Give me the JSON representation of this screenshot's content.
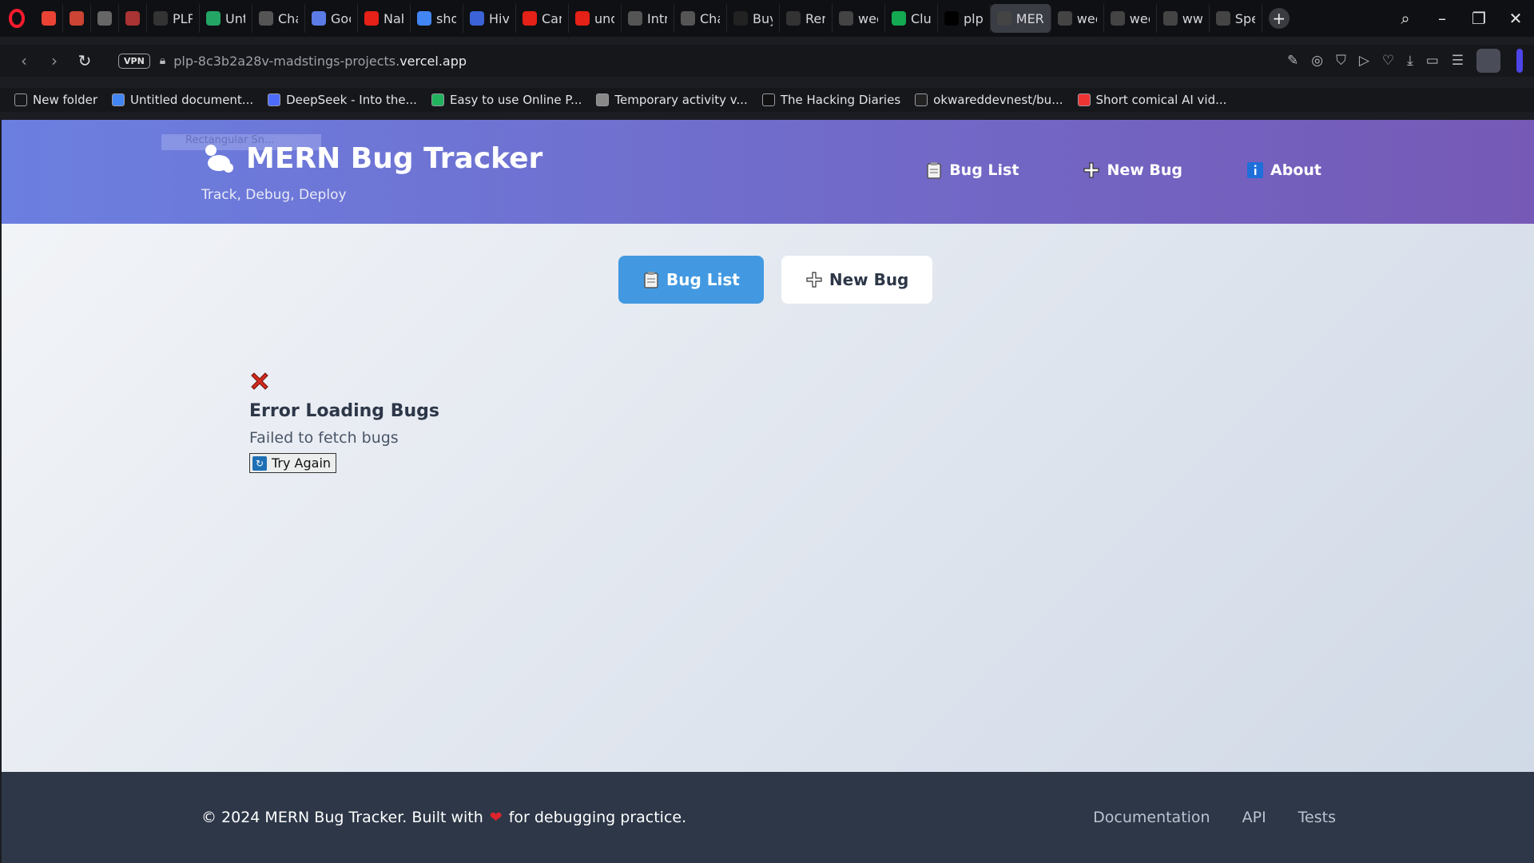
{
  "browser": {
    "tabs": [
      {
        "label": "",
        "icon": "gmail-icon",
        "color": "#ea4335"
      },
      {
        "label": "",
        "icon": "app-icon",
        "color": "#c43"
      },
      {
        "label": "",
        "icon": "screen-icon",
        "color": "#666"
      },
      {
        "label": "",
        "icon": "app-icon",
        "color": "#a33"
      },
      {
        "label": "PLP",
        "icon": "github-icon",
        "color": "#333"
      },
      {
        "label": "Unti",
        "icon": "sheets-icon",
        "color": "#23a566"
      },
      {
        "label": "Cha",
        "icon": "chatgpt-icon",
        "color": "#555"
      },
      {
        "label": "Goo",
        "icon": "gemini-icon",
        "color": "#5b7be6"
      },
      {
        "label": "Nah",
        "icon": "youtube-icon",
        "color": "#e62117"
      },
      {
        "label": "shov",
        "icon": "google-icon",
        "color": "#4285f4"
      },
      {
        "label": "Hive",
        "icon": "hive-icon",
        "color": "#3c63d8"
      },
      {
        "label": "Can",
        "icon": "youtube-icon",
        "color": "#e62117"
      },
      {
        "label": "und",
        "icon": "youtube-icon",
        "color": "#e62117"
      },
      {
        "label": "Intro",
        "icon": "chatgpt-icon",
        "color": "#555"
      },
      {
        "label": "Cha",
        "icon": "chatgpt-icon",
        "color": "#555"
      },
      {
        "label": "Buy",
        "icon": "x-icon",
        "color": "#222"
      },
      {
        "label": "Ren",
        "icon": "render-icon",
        "color": "#333"
      },
      {
        "label": "wee",
        "icon": "globe-icon",
        "color": "#444"
      },
      {
        "label": "Clus",
        "icon": "mongodb-icon",
        "color": "#13aa52"
      },
      {
        "label": "plp",
        "icon": "vercel-icon",
        "color": "#000"
      },
      {
        "label": "MER",
        "icon": "globe-icon",
        "color": "#444",
        "active": true
      },
      {
        "label": "wee",
        "icon": "globe-icon",
        "color": "#444"
      },
      {
        "label": "wee",
        "icon": "globe-icon",
        "color": "#444"
      },
      {
        "label": "www",
        "icon": "globe-icon",
        "color": "#444"
      },
      {
        "label": "Spe",
        "icon": "grid-icon",
        "color": "#444"
      }
    ],
    "vpn_label": "VPN",
    "url_prefix": "plp-8c3b2a28v-madstings-projects.",
    "url_domain": "vercel.app",
    "bookmarks": [
      {
        "label": "New folder",
        "icon": "folder-icon",
        "color": "#16171b"
      },
      {
        "label": "Untitled document...",
        "icon": "docs-icon",
        "color": "#4285f4"
      },
      {
        "label": "DeepSeek - Into the...",
        "icon": "deepseek-icon",
        "color": "#4d6bfe"
      },
      {
        "label": "Easy to use Online P...",
        "icon": "s-icon",
        "color": "#22b35e"
      },
      {
        "label": "Temporary activity v...",
        "icon": "activity-icon",
        "color": "#888"
      },
      {
        "label": "The Hacking Diaries",
        "icon": "circle-icon",
        "color": "#111"
      },
      {
        "label": "okwareddevnest/bu...",
        "icon": "github-icon",
        "color": "#222"
      },
      {
        "label": "Short comical AI vid...",
        "icon": "ai-icon",
        "color": "#e33"
      }
    ]
  },
  "app": {
    "ghost_text": "Rectangular Sn...",
    "title": "MERN Bug Tracker",
    "tagline": "Track, Debug, Deploy",
    "nav": {
      "bug_list": "Bug List",
      "new_bug": "New Bug",
      "about": "About"
    },
    "subnav": {
      "bug_list": "Bug List",
      "new_bug": "New Bug"
    },
    "error": {
      "title": "Error Loading Bugs",
      "message": "Failed to fetch bugs",
      "retry": "Try Again"
    },
    "footer": {
      "copy_before": "© 2024 MERN Bug Tracker. Built with",
      "copy_after": "for debugging practice.",
      "links": [
        "Documentation",
        "API",
        "Tests"
      ]
    }
  }
}
